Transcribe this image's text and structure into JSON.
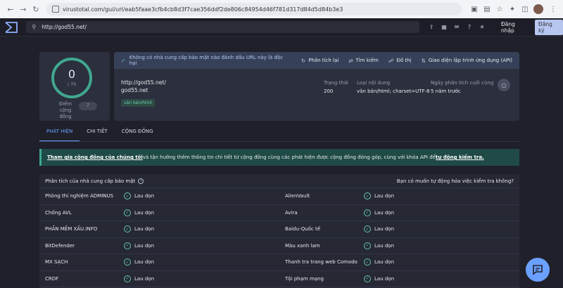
{
  "browser": {
    "url": "virustotal.com/gui/url/eab5faae3cfb4cb8d3f7cae356ddf2de806c84954d46f781d317d84d5d84b3e3"
  },
  "header": {
    "search_value": "http://god55.net/",
    "login_label": "Đăng nhập",
    "signup_label": "Đăng ký"
  },
  "score": {
    "detections": "0",
    "total": "/ 70",
    "community_label": "Điểm cộng đồng",
    "community_value": "?"
  },
  "summary": {
    "message": "Không có nhà cung cấp bảo mật nào đánh dấu URL này là độc hại",
    "actions": {
      "reanalyze": "Phân tích lại",
      "search": "Tìm kiếm",
      "graph": "Đồ thị",
      "api": "Giao diện lập trình ứng dụng (API)"
    },
    "url": "http://god55.net/",
    "domain": "god55.net",
    "tag": "văn bản/html",
    "status_label": "Trạng thái",
    "status_value": "200",
    "content_type_label": "Loại nội dung",
    "content_type_value": "văn bản/html; charset=UTF-8",
    "last_analysis_label": "Ngày phân tích cuối cùng",
    "last_analysis_value": "5 năm trước"
  },
  "tabs": [
    {
      "label": "PHÁT HIỆN"
    },
    {
      "label": "CHI TIẾT"
    },
    {
      "label": "CỘNG ĐỒNG"
    }
  ],
  "banner": {
    "link1": "Tham gia cộng đồng của chúng tôi",
    "text": " và tận hưởng thêm thông tin chi tiết từ cộng đồng cùng các phát hiện được cộng đồng đóng góp, cùng với khóa API để ",
    "link2": "tự động kiểm tra."
  },
  "vendors": {
    "title": "Phân tích của nhà cung cấp bảo mật",
    "automate_question": "Bạn có muốn tự động hóa việc kiểm tra không?",
    "rows": [
      {
        "left_name": "Phòng thí nghiệm ADMINUS",
        "left_result": "Lau dọn",
        "right_name": "AlienVault",
        "right_result": "Lau dọn"
      },
      {
        "left_name": "Chống AVL",
        "left_result": "Lau dọn",
        "right_name": "Avira",
        "right_result": "Lau dọn"
      },
      {
        "left_name": "PHẦN MỀM XẤU.INFO",
        "left_result": "Lau dọn",
        "right_name": "Baidu-Quốc tế",
        "right_result": "Lau dọn"
      },
      {
        "left_name": "BitDefender",
        "left_result": "Lau dọn",
        "right_name": "Màu xanh lam",
        "right_result": "Lau dọn"
      },
      {
        "left_name": "MX SẠCH",
        "left_result": "Lau dọn",
        "right_name": "Thanh tra trang web Comodo",
        "right_result": "Lau dọn"
      },
      {
        "left_name": "CRDF",
        "left_result": "Lau dọn",
        "right_name": "Tội phạm mạng",
        "right_result": "Lau dọn"
      }
    ]
  },
  "colors": {
    "accent": "#6aa0ff",
    "clean": "#66c9a9",
    "background": "#1f2029"
  }
}
